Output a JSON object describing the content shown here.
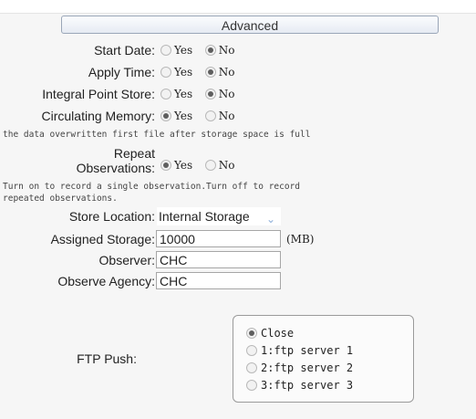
{
  "advanced_label": "Advanced",
  "rows": {
    "start_date": {
      "label": "Start Date:",
      "yes": "Yes",
      "no": "No",
      "selected": "No"
    },
    "apply_time": {
      "label": "Apply Time:",
      "yes": "Yes",
      "no": "No",
      "selected": "No"
    },
    "integral_point_store": {
      "label": "Integral Point Store:",
      "yes": "Yes",
      "no": "No",
      "selected": "No"
    },
    "circulating_memory": {
      "label": "Circulating Memory:",
      "yes": "Yes",
      "no": "No",
      "selected": "Yes"
    },
    "repeat_observations": {
      "label_line1": "Repeat",
      "label_line2": "Observations:",
      "yes": "Yes",
      "no": "No",
      "selected": "Yes"
    }
  },
  "notes": {
    "circulating": "the data overwritten first file after storage space is full",
    "repeat_line1": "Turn on to record a single observation.Turn off to record",
    "repeat_line2": "repeated observations."
  },
  "store_location": {
    "label": "Store Location:",
    "value": "Internal Storage"
  },
  "assigned_storage": {
    "label": "Assigned Storage:",
    "value": "10000",
    "unit": "(MB)"
  },
  "observer": {
    "label": "Observer:",
    "value": "CHC"
  },
  "observe_agency": {
    "label": "Observe Agency:",
    "value": "CHC"
  },
  "ftp_push": {
    "label": "FTP Push:",
    "options": [
      "Close",
      "1:ftp server 1",
      "2:ftp server 2",
      "3:ftp server 3"
    ],
    "selected": "Close"
  }
}
